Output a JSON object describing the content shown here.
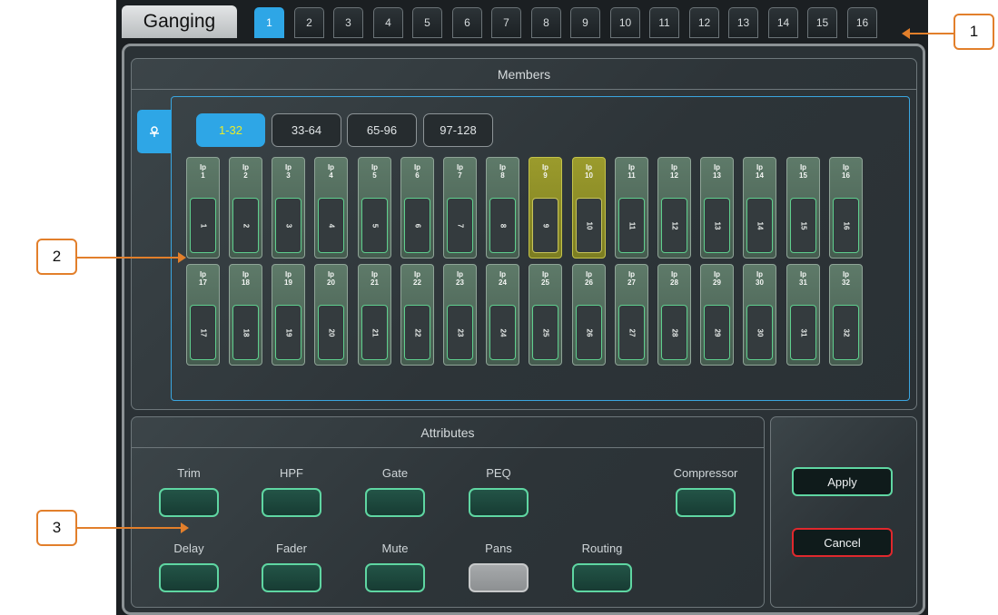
{
  "header": {
    "title": "Ganging"
  },
  "gang_tabs": [
    "1",
    "2",
    "3",
    "4",
    "5",
    "6",
    "7",
    "8",
    "9",
    "10",
    "11",
    "12",
    "13",
    "14",
    "15",
    "16"
  ],
  "members": {
    "title": "Members",
    "side_icon": "input-icon",
    "banks": [
      "1-32",
      "33-64",
      "65-96",
      "97-128"
    ],
    "channels_row1": [
      {
        "top": "Ip\n1",
        "num": "1"
      },
      {
        "top": "Ip\n2",
        "num": "2"
      },
      {
        "top": "Ip\n3",
        "num": "3"
      },
      {
        "top": "Ip\n4",
        "num": "4"
      },
      {
        "top": "Ip\n5",
        "num": "5"
      },
      {
        "top": "Ip\n6",
        "num": "6"
      },
      {
        "top": "Ip\n7",
        "num": "7"
      },
      {
        "top": "Ip\n8",
        "num": "8"
      },
      {
        "top": "Ip\n9",
        "num": "9"
      },
      {
        "top": "Ip\n10",
        "num": "10"
      },
      {
        "top": "Ip\n11",
        "num": "11"
      },
      {
        "top": "Ip\n12",
        "num": "12"
      },
      {
        "top": "Ip\n13",
        "num": "13"
      },
      {
        "top": "Ip\n14",
        "num": "14"
      },
      {
        "top": "Ip\n15",
        "num": "15"
      },
      {
        "top": "Ip\n16",
        "num": "16"
      }
    ],
    "channels_row2": [
      {
        "top": "Ip\n17",
        "num": "17"
      },
      {
        "top": "Ip\n18",
        "num": "18"
      },
      {
        "top": "Ip\n19",
        "num": "19"
      },
      {
        "top": "Ip\n20",
        "num": "20"
      },
      {
        "top": "Ip\n21",
        "num": "21"
      },
      {
        "top": "Ip\n22",
        "num": "22"
      },
      {
        "top": "Ip\n23",
        "num": "23"
      },
      {
        "top": "Ip\n24",
        "num": "24"
      },
      {
        "top": "Ip\n25",
        "num": "25"
      },
      {
        "top": "Ip\n26",
        "num": "26"
      },
      {
        "top": "Ip\n27",
        "num": "27"
      },
      {
        "top": "Ip\n28",
        "num": "28"
      },
      {
        "top": "Ip\n29",
        "num": "29"
      },
      {
        "top": "Ip\n30",
        "num": "30"
      },
      {
        "top": "Ip\n31",
        "num": "31"
      },
      {
        "top": "Ip\n32",
        "num": "32"
      }
    ]
  },
  "attributes": {
    "title": "Attributes",
    "trim": "Trim",
    "hpf": "HPF",
    "gate": "Gate",
    "peq": "PEQ",
    "compressor": "Compressor",
    "delay": "Delay",
    "fader": "Fader",
    "mute": "Mute",
    "pans": "Pans",
    "routing": "Routing"
  },
  "actions": {
    "apply": "Apply",
    "cancel": "Cancel"
  },
  "callouts": [
    "1",
    "2",
    "3"
  ],
  "colors": {
    "accent_blue": "#2ea6e6",
    "selected_olive": "#8f8f28",
    "active_green": "#5fd6a2",
    "cancel_red": "#e0282d",
    "callout_orange": "#e27f2b"
  }
}
